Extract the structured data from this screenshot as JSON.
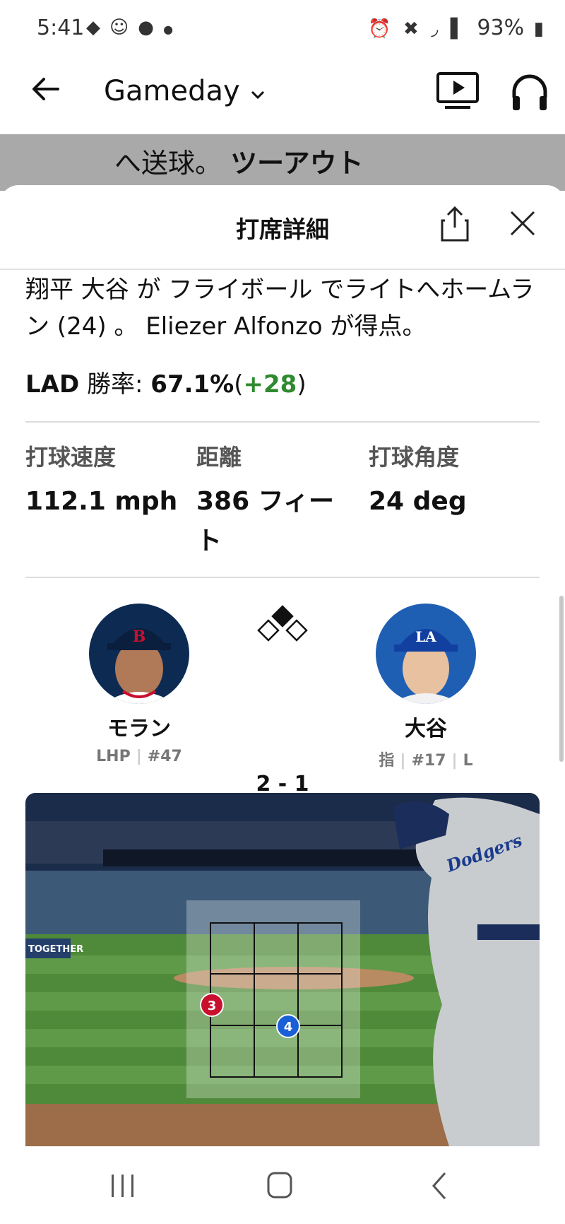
{
  "status_bar": {
    "time": "5:41",
    "left_icons": [
      "shield-icon",
      "headset-icon",
      "baseball-icon",
      "dot-icon"
    ],
    "right_icons": [
      "alarm-icon",
      "mute-icon",
      "wifi-icon",
      "signal-icon"
    ],
    "battery": "93%"
  },
  "app_bar": {
    "title": "Gameday",
    "dropdown_icon": "chevron-down-icon",
    "back_icon": "back-arrow-icon",
    "tv_icon": "tv-play-icon",
    "audio_icon": "headphones-icon"
  },
  "behind_text": {
    "normal": "へ送球。",
    "bold": "ツーアウト"
  },
  "sheet": {
    "title": "打席詳細",
    "description": "翔平 大谷 が フライボール でライトへホームラン (24) 。 Eliezer Alfonzo が得点。",
    "win_prob": {
      "team": "LAD",
      "label": "勝率:",
      "value": "67.1%",
      "open": "(",
      "delta": "+28",
      "close": ")"
    },
    "stats": [
      {
        "label": "打球速度",
        "value": "112.1 mph"
      },
      {
        "label": "距離",
        "value": "386 フィート"
      },
      {
        "label": "打球角度",
        "value": "24 deg"
      }
    ],
    "pitcher": {
      "name": "モラン",
      "hand": "LHP",
      "number": "#47",
      "cap_logo": "B"
    },
    "batter": {
      "name": "大谷",
      "pos": "指",
      "number": "#17",
      "bats": "L",
      "cap_logo": "LA"
    },
    "count": "2 - 1",
    "bases": {
      "first": false,
      "second": true,
      "third": false
    },
    "outs": [
      true,
      true,
      false
    ],
    "pitches": [
      {
        "number": "3",
        "color": "#c8102e"
      },
      {
        "number": "4",
        "color": "#1a5fd6"
      }
    ],
    "banner_text": "TOGETHER",
    "jersey_text": "Dodgers"
  },
  "colors": {
    "green": "#2f8a2f",
    "pitch_red": "#c8102e",
    "pitch_blue": "#1a5fd6"
  },
  "nav_bar": {
    "recents_icon": "recents-icon",
    "home_icon": "home-icon",
    "back_icon": "back-chevron-icon"
  }
}
